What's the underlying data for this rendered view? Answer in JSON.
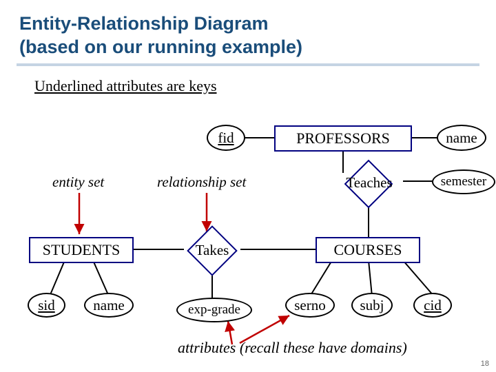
{
  "slide": {
    "title_line1": "Entity-Relationship Diagram",
    "title_line2": "(based on our running example)",
    "subtitle": "Underlined attributes are keys",
    "slide_number": "18"
  },
  "annotations": {
    "entity_set": "entity set",
    "relationship_set": "relationship set",
    "attributes_note_1": "attributes",
    "attributes_note_2": " (recall these have domains)"
  },
  "entities": {
    "professors": {
      "label": "PROFESSORS",
      "attrs": {
        "fid": "fid",
        "name": "name"
      }
    },
    "students": {
      "label": "STUDENTS",
      "attrs": {
        "sid": "sid",
        "name": "name"
      }
    },
    "courses": {
      "label": "COURSES",
      "attrs": {
        "serno": "serno",
        "subj": "subj",
        "cid": "cid"
      }
    }
  },
  "relationships": {
    "teaches": {
      "label": "Teaches",
      "attrs": {
        "semester": "semester"
      }
    },
    "takes": {
      "label": "Takes",
      "attrs": {
        "exp_grade": "exp-grade"
      }
    }
  },
  "chart_data": {
    "type": "table",
    "description": "ER diagram",
    "entities": [
      {
        "name": "PROFESSORS",
        "attributes": [
          {
            "name": "fid",
            "key": true
          },
          {
            "name": "name",
            "key": false
          }
        ]
      },
      {
        "name": "STUDENTS",
        "attributes": [
          {
            "name": "sid",
            "key": true
          },
          {
            "name": "name",
            "key": false
          }
        ]
      },
      {
        "name": "COURSES",
        "attributes": [
          {
            "name": "serno",
            "key": false
          },
          {
            "name": "subj",
            "key": false
          },
          {
            "name": "cid",
            "key": true
          }
        ]
      }
    ],
    "relationships": [
      {
        "name": "Teaches",
        "between": [
          "PROFESSORS",
          "COURSES"
        ],
        "attributes": [
          {
            "name": "semester",
            "key": false
          }
        ]
      },
      {
        "name": "Takes",
        "between": [
          "STUDENTS",
          "COURSES"
        ],
        "attributes": [
          {
            "name": "exp-grade",
            "key": false
          }
        ]
      }
    ]
  }
}
